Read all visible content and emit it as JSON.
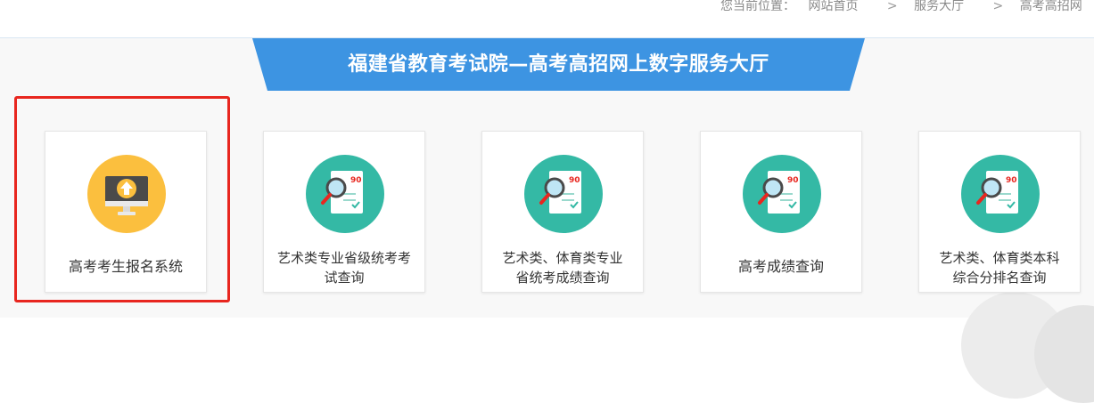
{
  "breadcrumb": {
    "prefix": "您当前位置：",
    "items": [
      "网站首页",
      "服务大厅",
      "高考高招网"
    ],
    "separator": ">"
  },
  "banner": {
    "title": "福建省教育考试院—高考高招网上数字服务大厅"
  },
  "colors": {
    "banner": "#3d94e2",
    "highlight": "#e8261f",
    "orange_icon": "#fbbf3e",
    "teal_icon": "#34b9a5"
  },
  "cards": [
    {
      "label": "高考考生报名系统",
      "icon": "monitor-upload-icon"
    },
    {
      "label_line1": "艺术类专业省级统考考",
      "label_line2": "试查询",
      "icon": "score-search-icon"
    },
    {
      "label_line1": "艺术类、体育类专业",
      "label_line2": "省统考成绩查询",
      "icon": "score-search-icon"
    },
    {
      "label": "高考成绩查询",
      "icon": "score-search-icon"
    },
    {
      "label_line1": "艺术类、体育类本科",
      "label_line2": "综合分排名查询",
      "icon": "score-search-icon"
    }
  ],
  "score_badge": "90"
}
